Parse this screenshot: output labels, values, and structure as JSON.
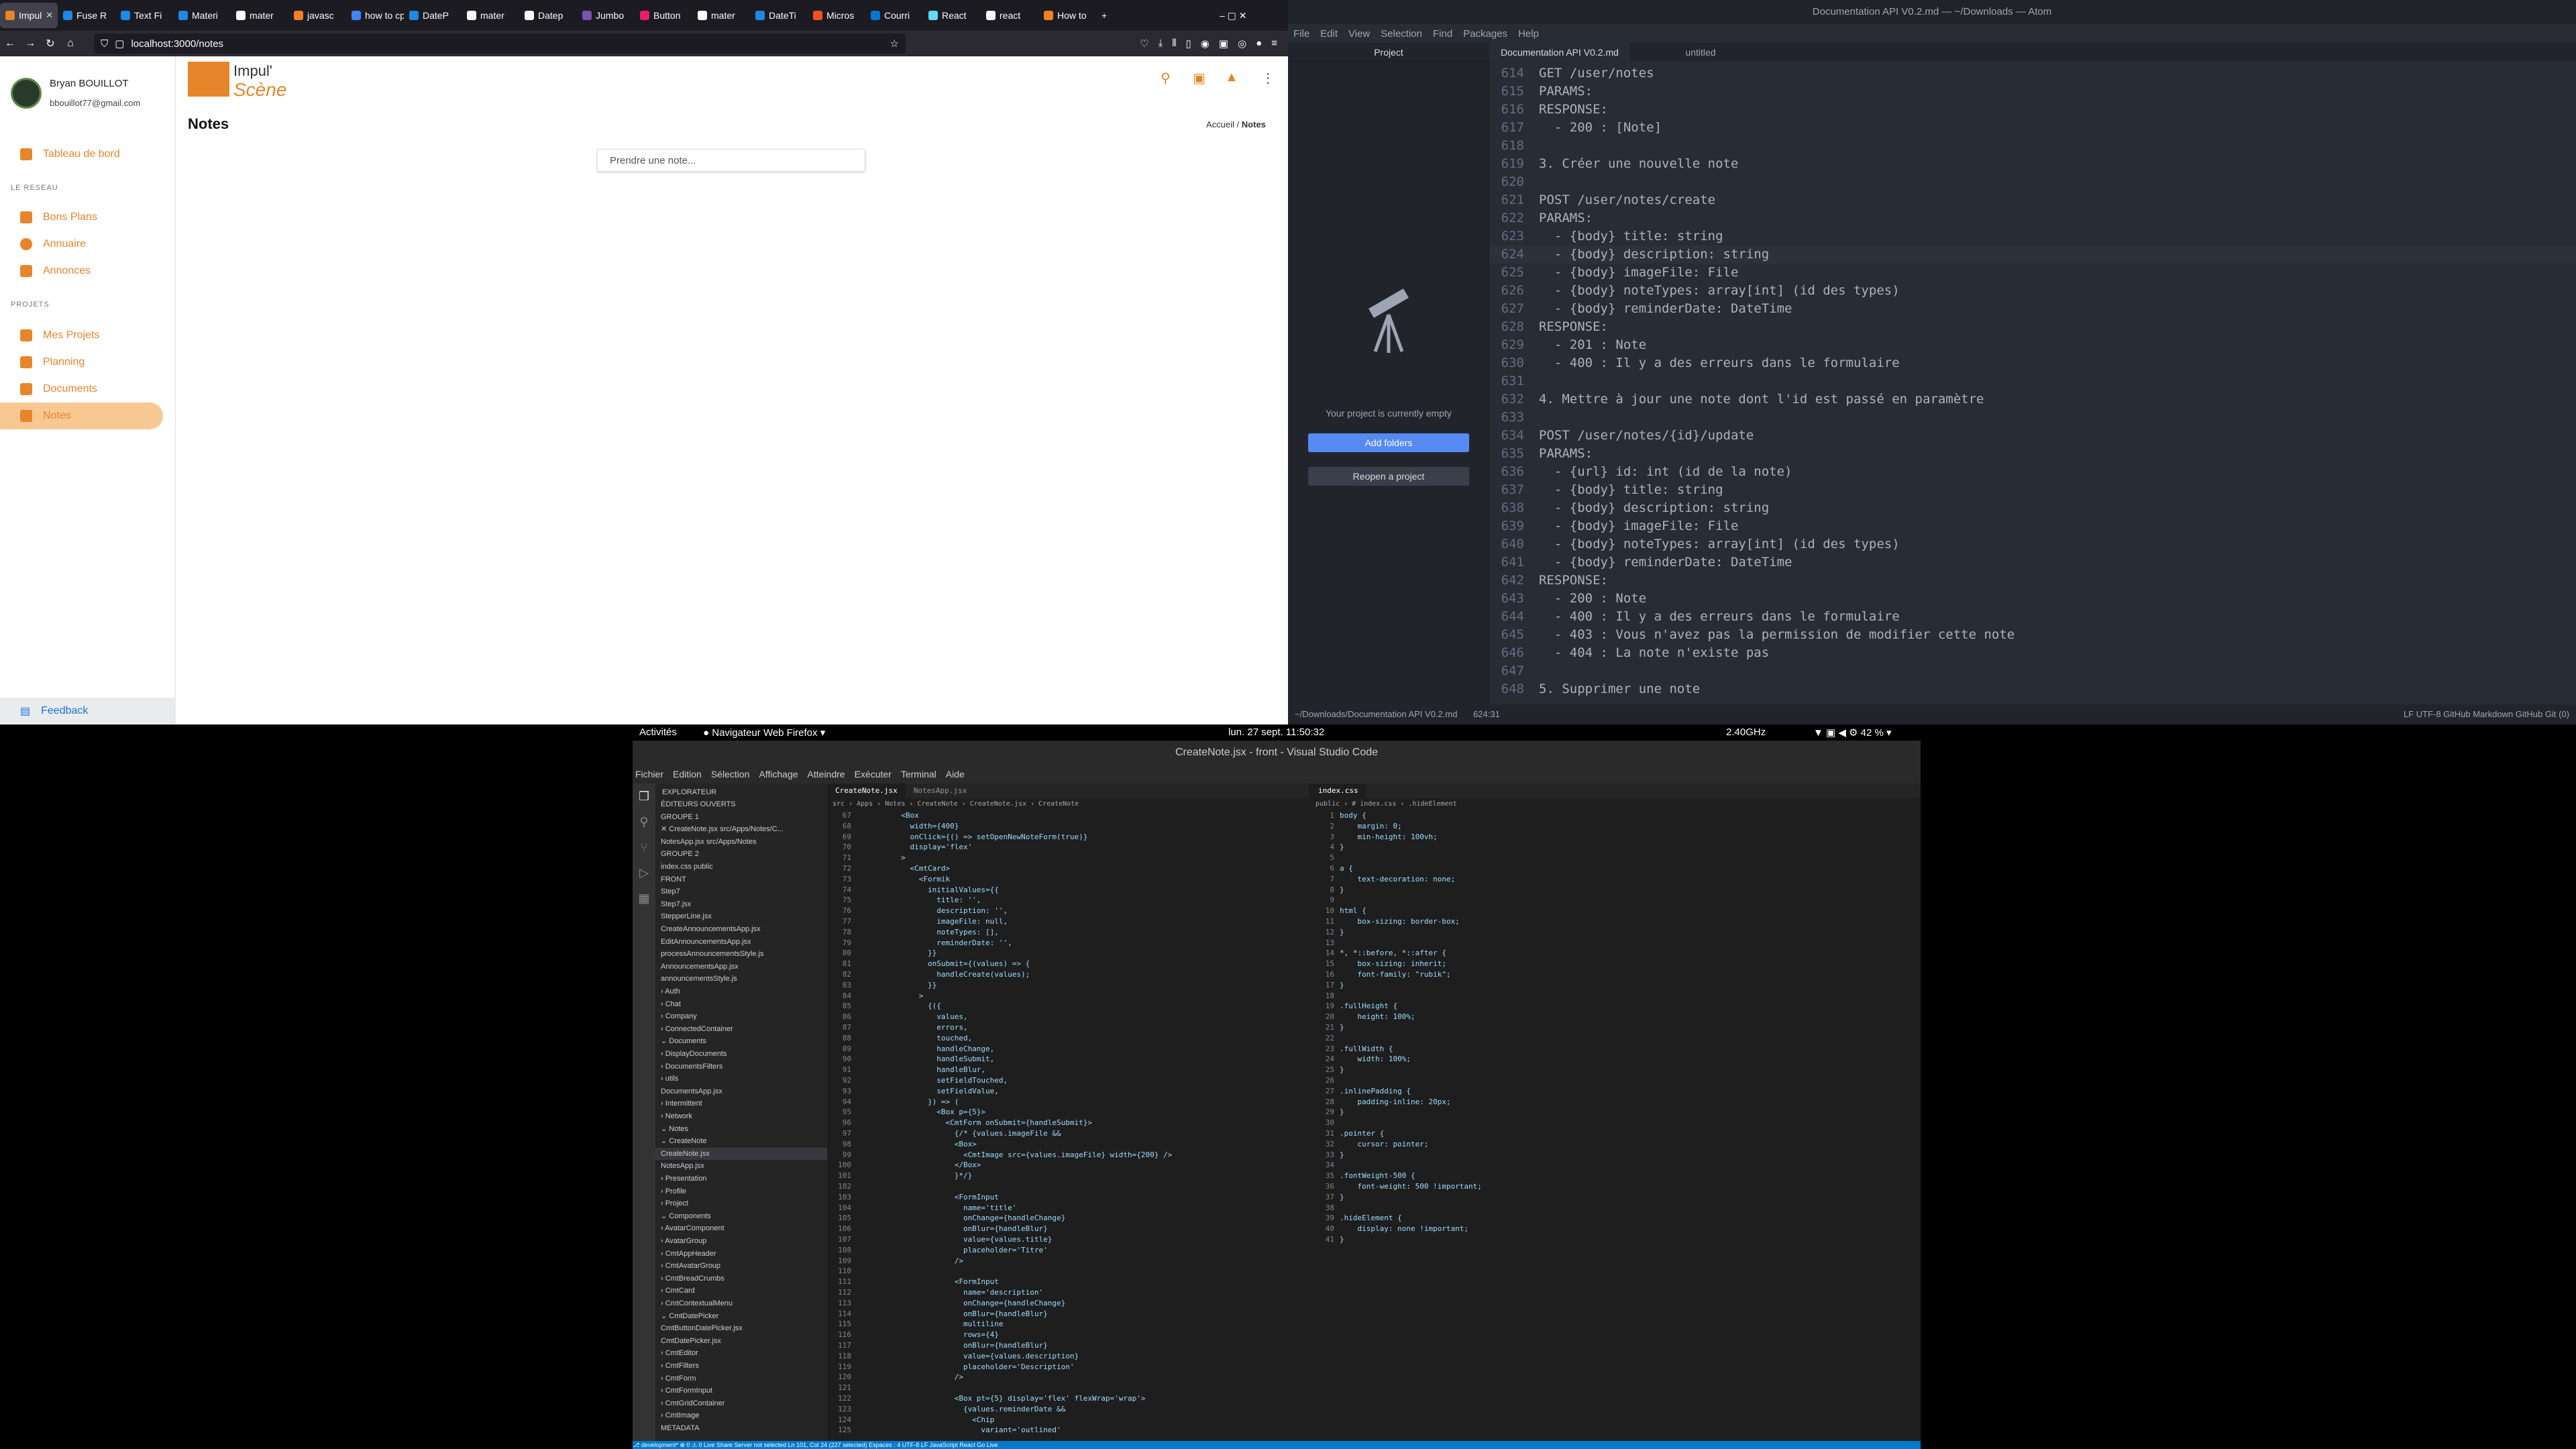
{
  "firefox": {
    "tabs": [
      {
        "label": "Impul",
        "color": "#e7852b",
        "active": true
      },
      {
        "label": "Fuse R",
        "color": "#1e88e5"
      },
      {
        "label": "Text Fi",
        "color": "#1e88e5"
      },
      {
        "label": "Materi",
        "color": "#1e88e5"
      },
      {
        "label": "mater",
        "color": "#fbfbfe"
      },
      {
        "label": "javasc",
        "color": "#f48024"
      },
      {
        "label": "how to cp",
        "color": "#4285f4"
      },
      {
        "label": "DateP",
        "color": "#1e88e5"
      },
      {
        "label": "mater",
        "color": "#fbfbfe"
      },
      {
        "label": "Datep",
        "color": "#fbfbfe"
      },
      {
        "label": "Jumbo",
        "color": "#7952b3"
      },
      {
        "label": "Button",
        "color": "#e91e63"
      },
      {
        "label": "mater",
        "color": "#fbfbfe"
      },
      {
        "label": "DateTi",
        "color": "#1e88e5"
      },
      {
        "label": "Micros",
        "color": "#f25022"
      },
      {
        "label": "Courri",
        "color": "#0078d4"
      },
      {
        "label": "React",
        "color": "#61dafb"
      },
      {
        "label": "react",
        "color": "#fbfbfe"
      },
      {
        "label": "How to",
        "color": "#f48024"
      }
    ],
    "url": "localhost:3000/notes",
    "app": {
      "user_name": "Bryan BOUILLOT",
      "user_email": "bbouillot77@gmail.com",
      "nav_dashboard": "Tableau de bord",
      "section_network": "LE RESEAU",
      "nav_deals": "Bons Plans",
      "nav_directory": "Annuaire",
      "nav_ads": "Annonces",
      "section_projects": "PROJETS",
      "nav_projects": "Mes Projets",
      "nav_planning": "Planning",
      "nav_documents": "Documents",
      "nav_notes": "Notes",
      "feedback": "Feedback",
      "logo_top": "Impul'",
      "logo_bottom": "Scène",
      "page_title": "Notes",
      "breadcrumb_home": "Accueil",
      "breadcrumb_sep": "/",
      "breadcrumb_current": "Notes",
      "note_placeholder": "Prendre une note...",
      "accent": "#e7852b"
    }
  },
  "atom": {
    "title": "Documentation API V0.2.md — ~/Downloads — Atom",
    "menu": [
      "File",
      "Edit",
      "View",
      "Selection",
      "Find",
      "Packages",
      "Help"
    ],
    "tree_tab": "Project",
    "empty_text": "Your project is currently empty",
    "add_folders": "Add folders",
    "reopen": "Reopen a project",
    "tabs": [
      "Documentation API V0.2.md",
      "untitled"
    ],
    "lines": [
      {
        "n": "614",
        "t": "GET /user/notes"
      },
      {
        "n": "615",
        "t": "PARAMS:"
      },
      {
        "n": "616",
        "t": "RESPONSE:"
      },
      {
        "n": "617",
        "t": "  - 200 : [Note]"
      },
      {
        "n": "618",
        "t": ""
      },
      {
        "n": "619",
        "t": "3. Créer une nouvelle note"
      },
      {
        "n": "620",
        "t": ""
      },
      {
        "n": "621",
        "t": "POST /user/notes/create"
      },
      {
        "n": "622",
        "t": "PARAMS:"
      },
      {
        "n": "623",
        "t": "  - {body} title: string"
      },
      {
        "n": "624",
        "t": "  - {body} description: string"
      },
      {
        "n": "625",
        "t": "  - {body} imageFile: File"
      },
      {
        "n": "626",
        "t": "  - {body} noteTypes: array[int] (id des types)"
      },
      {
        "n": "627",
        "t": "  - {body} reminderDate: DateTime"
      },
      {
        "n": "628",
        "t": "RESPONSE:"
      },
      {
        "n": "629",
        "t": "  - 201 : Note"
      },
      {
        "n": "630",
        "t": "  - 400 : Il y a des erreurs dans le formulaire"
      },
      {
        "n": "631",
        "t": ""
      },
      {
        "n": "632",
        "t": "4. Mettre à jour une note dont l'id est passé en paramètre"
      },
      {
        "n": "633",
        "t": ""
      },
      {
        "n": "634",
        "t": "POST /user/notes/{id}/update"
      },
      {
        "n": "635",
        "t": "PARAMS:"
      },
      {
        "n": "636",
        "t": "  - {url} id: int (id de la note)"
      },
      {
        "n": "637",
        "t": "  - {body} title: string"
      },
      {
        "n": "638",
        "t": "  - {body} description: string"
      },
      {
        "n": "639",
        "t": "  - {body} imageFile: File"
      },
      {
        "n": "640",
        "t": "  - {body} noteTypes: array[int] (id des types)"
      },
      {
        "n": "641",
        "t": "  - {body} reminderDate: DateTime"
      },
      {
        "n": "642",
        "t": "RESPONSE:"
      },
      {
        "n": "643",
        "t": "  - 200 : Note"
      },
      {
        "n": "644",
        "t": "  - 400 : Il y a des erreurs dans le formulaire"
      },
      {
        "n": "645",
        "t": "  - 403 : Vous n'avez pas la permission de modifier cette note"
      },
      {
        "n": "646",
        "t": "  - 404 : La note n'existe pas"
      },
      {
        "n": "647",
        "t": ""
      },
      {
        "n": "648",
        "t": "5. Supprimer une note"
      }
    ],
    "status_left": "~/Downloads/Documentation API V0.2.md",
    "status_pos": "624:31",
    "status_right": "LF   UTF-8   GitHub Markdown   GitHub   Git (0)"
  },
  "gnome": {
    "activities": "Activités",
    "app": "Navigateur Web Firefox",
    "clock": "lun. 27 sept.  11:50:32",
    "cpu": "2.40GHz",
    "battery": "42 %"
  },
  "vscode": {
    "title": "CreateNote.jsx - front - Visual Studio Code",
    "menu": [
      "Fichier",
      "Edition",
      "Sélection",
      "Affichage",
      "Atteindre",
      "Exécuter",
      "Terminal",
      "Aide"
    ],
    "explorer_title": "EXPLORATEUR",
    "explorer": [
      "ÉDITEURS OUVERTS",
      "GROUPE 1",
      "  ✕ CreateNote.jsx  src/Apps/Notes/C...",
      "    NotesApp.jsx  src/Apps/Notes",
      "GROUPE 2",
      "    index.css  public",
      "FRONT",
      "        Step7",
      "          Step7.jsx",
      "        StepperLine.jsx",
      "      CreateAnnouncementsApp.jsx",
      "      EditAnnouncementsApp.jsx",
      "      processAnnouncementsStyle.js",
      "    AnnouncementsApp.jsx",
      "    announcementsStyle.js",
      "  › Auth",
      "  › Chat",
      "  › Company",
      "  › ConnectedContainer",
      "  ⌄ Documents",
      "    › DisplayDocuments",
      "    › DocumentsFilters",
      "    › utils",
      "      DocumentsApp.jsx",
      "  › Intermittent",
      "  › Network",
      "  ⌄ Notes",
      "    ⌄ CreateNote",
      "        CreateNote.jsx",
      "      NotesApp.jsx",
      "  › Presentation",
      "  › Profile",
      "  › Project",
      "  ⌄ Components",
      "    › AvatarComponent",
      "    › AvatarGroup",
      "    › CmtAppHeader",
      "    › CmtAvatarGroup",
      "    › CmtBreadCrumbs",
      "    › CmtCard",
      "    › CmtContextualMenu",
      "    ⌄ CmtDatePicker",
      "        CmtButtonDatePicker.jsx",
      "        CmtDatePicker.jsx",
      "    › CmtEditor",
      "    › CmtFilters",
      "    › CmtForm",
      "    › CmtFormInput",
      "    › CmtGridContainer",
      "    › CmtImage",
      "METADATA"
    ],
    "tabs_left": [
      "CreateNote.jsx",
      "NotesApp.jsx"
    ],
    "crumb_left": "src › Apps › Notes › CreateNote › CreateNote.jsx › CreateNote",
    "code_left": [
      {
        "n": "67",
        "t": "          <Box"
      },
      {
        "n": "68",
        "t": "            width={400}"
      },
      {
        "n": "69",
        "t": "            onClick={() => setOpenNewNoteForm(true)}"
      },
      {
        "n": "70",
        "t": "            display='flex'"
      },
      {
        "n": "71",
        "t": "          >"
      },
      {
        "n": "72",
        "t": "            <CmtCard>"
      },
      {
        "n": "73",
        "t": "              <Formik"
      },
      {
        "n": "74",
        "t": "                initialValues={{"
      },
      {
        "n": "75",
        "t": "                  title: '',"
      },
      {
        "n": "76",
        "t": "                  description: '',"
      },
      {
        "n": "77",
        "t": "                  imageFile: null,"
      },
      {
        "n": "78",
        "t": "                  noteTypes: [],"
      },
      {
        "n": "79",
        "t": "                  reminderDate: '',"
      },
      {
        "n": "80",
        "t": "                }}"
      },
      {
        "n": "81",
        "t": "                onSubmit={(values) => {"
      },
      {
        "n": "82",
        "t": "                  handleCreate(values);"
      },
      {
        "n": "83",
        "t": "                }}"
      },
      {
        "n": "84",
        "t": "              >"
      },
      {
        "n": "85",
        "t": "                {({"
      },
      {
        "n": "86",
        "t": "                  values,"
      },
      {
        "n": "87",
        "t": "                  errors,"
      },
      {
        "n": "88",
        "t": "                  touched,"
      },
      {
        "n": "89",
        "t": "                  handleChange,"
      },
      {
        "n": "90",
        "t": "                  handleSubmit,"
      },
      {
        "n": "91",
        "t": "                  handleBlur,"
      },
      {
        "n": "92",
        "t": "                  setFieldTouched,"
      },
      {
        "n": "93",
        "t": "                  setFieldValue,"
      },
      {
        "n": "94",
        "t": "                }) => ("
      },
      {
        "n": "95",
        "t": "                  <Box p={5}>"
      },
      {
        "n": "96",
        "t": "                    <CmtForm onSubmit={handleSubmit}>"
      },
      {
        "n": "97",
        "t": "                      {/* {values.imageFile &&"
      },
      {
        "n": "98",
        "t": "                      <Box>"
      },
      {
        "n": "99",
        "t": "                        <CmtImage src={values.imageFile} width={200} />"
      },
      {
        "n": "100",
        "t": "                      </Box>"
      },
      {
        "n": "101",
        "t": "                      }*/}"
      },
      {
        "n": "102",
        "t": ""
      },
      {
        "n": "103",
        "t": "                      <FormInput"
      },
      {
        "n": "104",
        "t": "                        name='title'"
      },
      {
        "n": "105",
        "t": "                        onChange={handleChange}"
      },
      {
        "n": "106",
        "t": "                        onBlur={handleBlur}"
      },
      {
        "n": "107",
        "t": "                        value={values.title}"
      },
      {
        "n": "108",
        "t": "                        placeholder='Titre'"
      },
      {
        "n": "109",
        "t": "                      />"
      },
      {
        "n": "110",
        "t": ""
      },
      {
        "n": "111",
        "t": "                      <FormInput"
      },
      {
        "n": "112",
        "t": "                        name='description'"
      },
      {
        "n": "113",
        "t": "                        onChange={handleChange}"
      },
      {
        "n": "114",
        "t": "                        onBlur={handleBlur}"
      },
      {
        "n": "115",
        "t": "                        multiline"
      },
      {
        "n": "116",
        "t": "                        rows={4}"
      },
      {
        "n": "117",
        "t": "                        onBlur={handleBlur}"
      },
      {
        "n": "118",
        "t": "                        value={values.description}"
      },
      {
        "n": "119",
        "t": "                        placeholder='Description'"
      },
      {
        "n": "120",
        "t": "                      />"
      },
      {
        "n": "121",
        "t": ""
      },
      {
        "n": "122",
        "t": "                      <Box pt={5} display='flex' flexWrap='wrap'>"
      },
      {
        "n": "123",
        "t": "                        {values.reminderDate &&"
      },
      {
        "n": "124",
        "t": "                          <Chip"
      },
      {
        "n": "125",
        "t": "                            variant='outlined'"
      }
    ],
    "tabs_right": [
      "index.css"
    ],
    "crumb_right": "public › # index.css › .hideElement",
    "code_right": [
      {
        "n": "1",
        "t": "body {"
      },
      {
        "n": "2",
        "t": "    margin: 0;"
      },
      {
        "n": "3",
        "t": "    min-height: 100vh;"
      },
      {
        "n": "4",
        "t": "}"
      },
      {
        "n": "5",
        "t": ""
      },
      {
        "n": "6",
        "t": "a {"
      },
      {
        "n": "7",
        "t": "    text-decoration: none;"
      },
      {
        "n": "8",
        "t": "}"
      },
      {
        "n": "9",
        "t": ""
      },
      {
        "n": "10",
        "t": "html {"
      },
      {
        "n": "11",
        "t": "    box-sizing: border-box;"
      },
      {
        "n": "12",
        "t": "}"
      },
      {
        "n": "13",
        "t": ""
      },
      {
        "n": "14",
        "t": "*, *::before, *::after {"
      },
      {
        "n": "15",
        "t": "    box-sizing: inherit;"
      },
      {
        "n": "16",
        "t": "    font-family: \"rubik\";"
      },
      {
        "n": "17",
        "t": "}"
      },
      {
        "n": "18",
        "t": ""
      },
      {
        "n": "19",
        "t": ".fullHeight {"
      },
      {
        "n": "20",
        "t": "    height: 100%;"
      },
      {
        "n": "21",
        "t": "}"
      },
      {
        "n": "22",
        "t": ""
      },
      {
        "n": "23",
        "t": ".fullWidth {"
      },
      {
        "n": "24",
        "t": "    width: 100%;"
      },
      {
        "n": "25",
        "t": "}"
      },
      {
        "n": "26",
        "t": ""
      },
      {
        "n": "27",
        "t": ".inlinePadding {"
      },
      {
        "n": "28",
        "t": "    padding-inline: 20px;"
      },
      {
        "n": "29",
        "t": "}"
      },
      {
        "n": "30",
        "t": ""
      },
      {
        "n": "31",
        "t": ".pointer {"
      },
      {
        "n": "32",
        "t": "    cursor: pointer;"
      },
      {
        "n": "33",
        "t": "}"
      },
      {
        "n": "34",
        "t": ""
      },
      {
        "n": "35",
        "t": ".fontWeight-500 {"
      },
      {
        "n": "36",
        "t": "    font-weight: 500 !important;"
      },
      {
        "n": "37",
        "t": "}"
      },
      {
        "n": "38",
        "t": ""
      },
      {
        "n": "39",
        "t": ".hideElement {"
      },
      {
        "n": "40",
        "t": "    display: none !important;"
      },
      {
        "n": "41",
        "t": "}"
      }
    ],
    "status": "⎇ development*   ⊗ 0 ⚠ 0   Live Share   Server not selected                              Ln 101, Col 24 (227 selected)   Espaces : 4   UTF-8   LF   JavaScript React   Go Live"
  }
}
